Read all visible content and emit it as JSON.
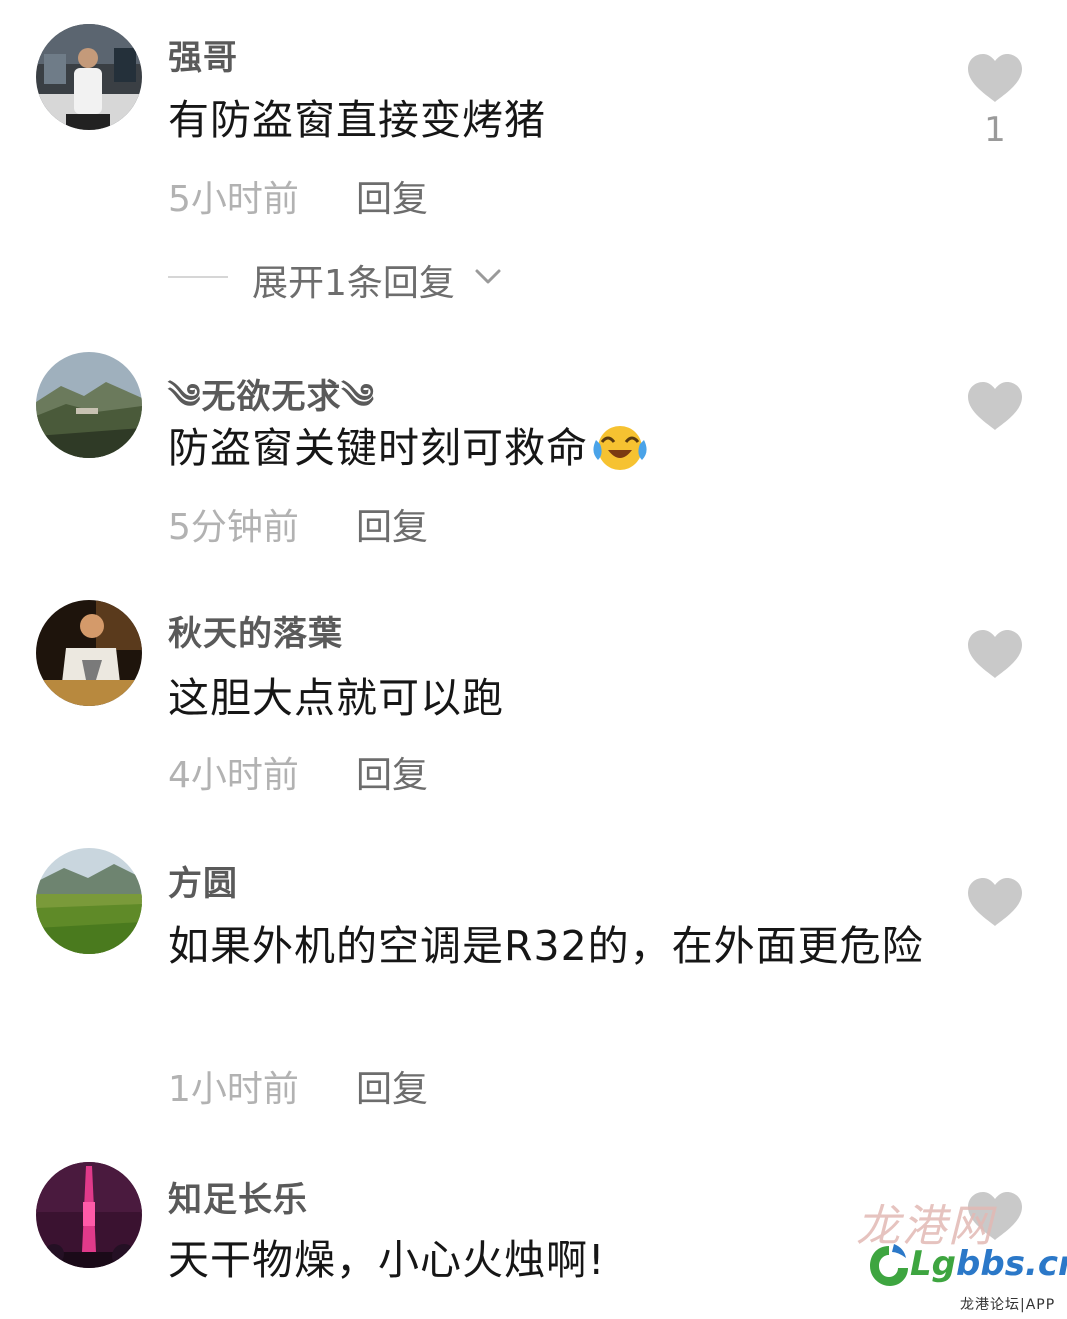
{
  "comments": [
    {
      "username": "强哥",
      "text": "有防盗窗直接变烤猪",
      "time": "5小时前",
      "reply_label": "回复",
      "like_icon": "heart-icon",
      "like_count": "1",
      "expand_label": "展开1条回复"
    },
    {
      "username": "༄无欲无求༄",
      "text": "防盗窗关键时刻可救命",
      "emoji": "crying-laughing-emoji",
      "time": "5分钟前",
      "reply_label": "回复",
      "like_icon": "heart-icon"
    },
    {
      "username": "秋天的落葉",
      "text": "这胆大点就可以跑",
      "time": "4小时前",
      "reply_label": "回复",
      "like_icon": "heart-icon"
    },
    {
      "username": "方圆",
      "text": "如果外机的空调是R32的，在外面更危险",
      "time": "1小时前",
      "reply_label": "回复",
      "like_icon": "heart-icon"
    },
    {
      "username": "知足长乐",
      "text": "天干物燥，小心火烛啊!",
      "like_icon": "heart-icon"
    }
  ],
  "watermark": {
    "calligraphy": "龙港网",
    "logo_prefix": "Lg",
    "logo_suffix": "bbs.cn",
    "caption": "龙港论坛|APP"
  },
  "colors": {
    "username": "#5a5a5a",
    "comment_text": "#161616",
    "timestamp": "#b2b2b2",
    "reply": "#6d6d6d",
    "heart": "#c9c9c9"
  }
}
